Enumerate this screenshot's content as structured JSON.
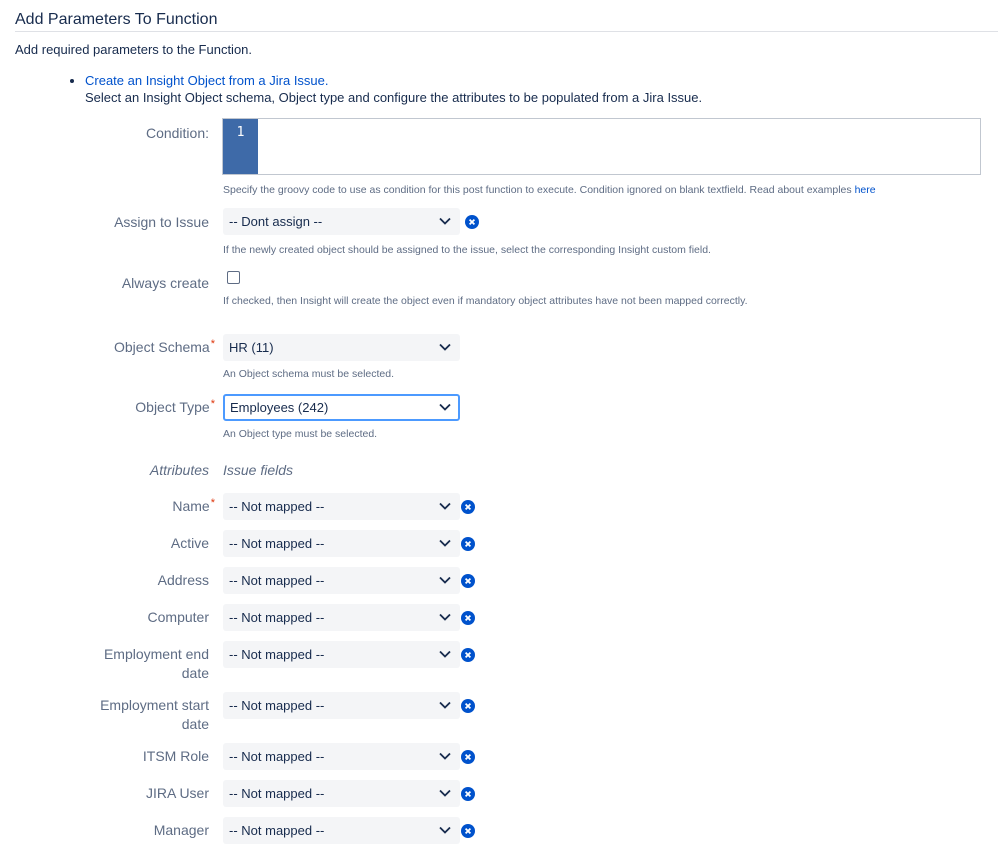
{
  "header": {
    "title": "Add Parameters To Function",
    "intro": "Add required parameters to the Function."
  },
  "bullet": {
    "link": "Create an Insight Object from a Jira Issue.",
    "description": "Select an Insight Object schema, Object type and configure the attributes to be populated from a Jira Issue."
  },
  "condition": {
    "label": "Condition:",
    "line_number": "1",
    "help": "Specify the groovy code to use as condition for this post function to execute. Condition ignored on blank textfield. Read about examples ",
    "help_link": "here"
  },
  "assign": {
    "label": "Assign to Issue",
    "value": "-- Dont assign --",
    "help": "If the newly created object should be assigned to the issue, select the corresponding Insight custom field."
  },
  "always_create": {
    "label": "Always create",
    "checked": false,
    "help": "If checked, then Insight will create the object even if mandatory object attributes have not been mapped correctly."
  },
  "object_schema": {
    "label": "Object Schema",
    "value": "HR (11)",
    "help": "An Object schema must be selected."
  },
  "object_type": {
    "label": "Object Type",
    "value": "Employees (242)",
    "help": "An Object type must be selected."
  },
  "mapping_header": {
    "left": "Attributes",
    "right": "Issue fields"
  },
  "attributes": [
    {
      "line1": "Name",
      "line2": "",
      "required": true,
      "value": "-- Not mapped --"
    },
    {
      "line1": "Active",
      "line2": "",
      "required": false,
      "value": "-- Not mapped --"
    },
    {
      "line1": "Address",
      "line2": "",
      "required": false,
      "value": "-- Not mapped --"
    },
    {
      "line1": "Computer",
      "line2": "",
      "required": false,
      "value": "-- Not mapped --"
    },
    {
      "line1": "Employment end",
      "line2": "date",
      "required": false,
      "value": "-- Not mapped --"
    },
    {
      "line1": "Employment start",
      "line2": "date",
      "required": false,
      "value": "-- Not mapped --"
    },
    {
      "line1": "ITSM Role",
      "line2": "",
      "required": false,
      "value": "-- Not mapped --"
    },
    {
      "line1": "JIRA User",
      "line2": "",
      "required": false,
      "value": "-- Not mapped --"
    },
    {
      "line1": "Manager",
      "line2": "",
      "required": false,
      "value": "-- Not mapped --"
    }
  ],
  "required_mark": "*",
  "colors": {
    "link": "#0052cc",
    "clear_icon": "#0052cc",
    "required": "#de350b",
    "focus": "#4c9aff",
    "gutter": "#3e6aa8"
  }
}
